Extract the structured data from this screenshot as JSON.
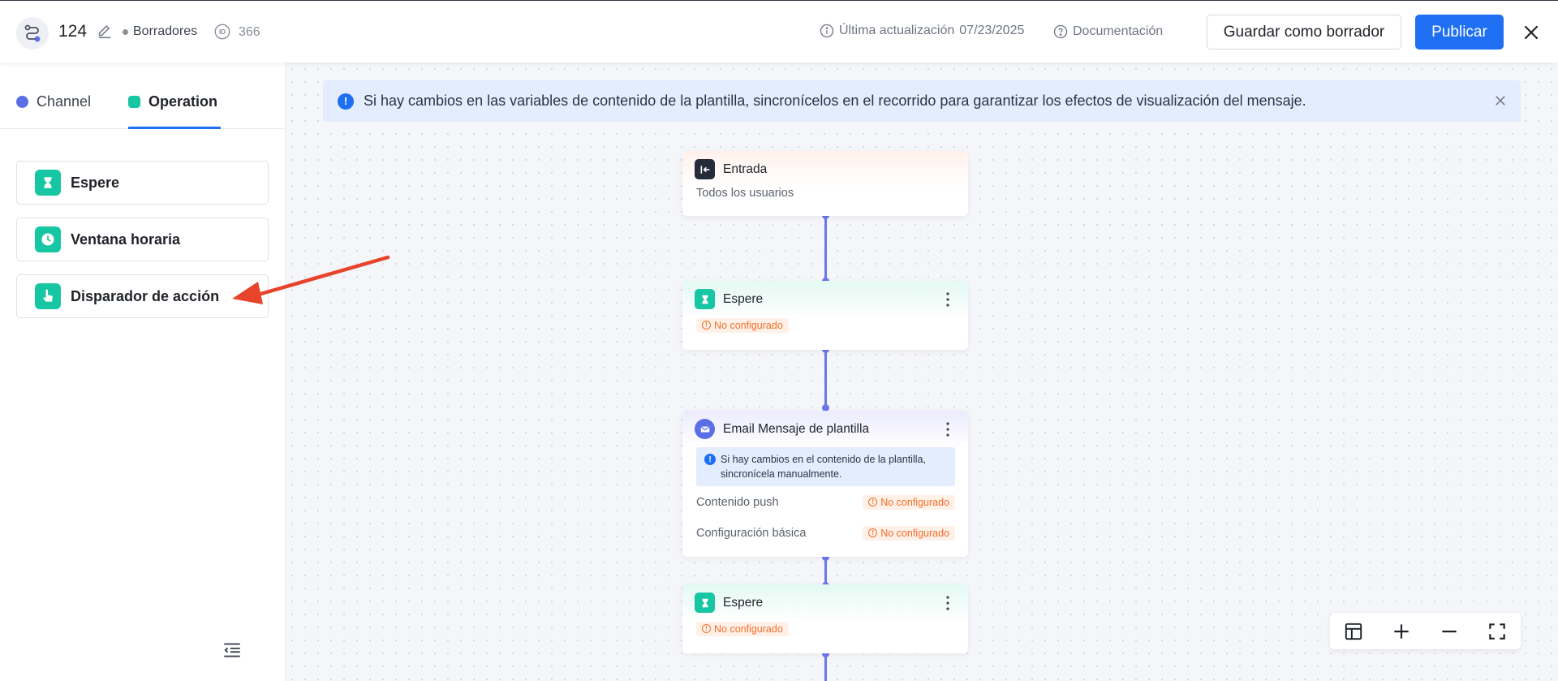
{
  "header": {
    "journey_name": "124",
    "status": "Borradores",
    "id_value": "366",
    "last_updated_label": "Última actualización",
    "last_updated_date": "07/23/2025",
    "docs_label": "Documentación",
    "save_draft_label": "Guardar como borrador",
    "publish_label": "Publicar"
  },
  "sidebar": {
    "tabs": [
      {
        "label": "Channel",
        "color": "#5b6ee8"
      },
      {
        "label": "Operation",
        "color": "#17c7a3",
        "active": true
      }
    ],
    "operations": [
      {
        "label": "Espere",
        "icon": "hourglass-icon"
      },
      {
        "label": "Ventana horaria",
        "icon": "clock-icon"
      },
      {
        "label": "Disparador de acción",
        "icon": "hand-pointer-icon"
      }
    ]
  },
  "canvas": {
    "banner_text": "Si hay cambios en las variables de contenido de la plantilla, sincronícelos en el recorrido para garantizar los efectos de visualización del mensaje.",
    "nodes": {
      "entry": {
        "title": "Entrada",
        "subtitle": "Todos los usuarios"
      },
      "wait1": {
        "title": "Espere",
        "badge": "No configurado"
      },
      "email": {
        "title": "Email Mensaje de plantilla",
        "note": "Si hay cambios en el contenido de la plantilla, sincronícela manualmente.",
        "rows": [
          {
            "label": "Contenido push",
            "badge": "No configurado"
          },
          {
            "label": "Configuración básica",
            "badge": "No configurado"
          }
        ]
      },
      "wait2": {
        "title": "Espere",
        "badge": "No configurado"
      }
    }
  },
  "colors": {
    "accent": "#1f6ff2",
    "operation_green": "#17c7a3",
    "connector": "#6c78e8",
    "warning": "#f0702a"
  }
}
